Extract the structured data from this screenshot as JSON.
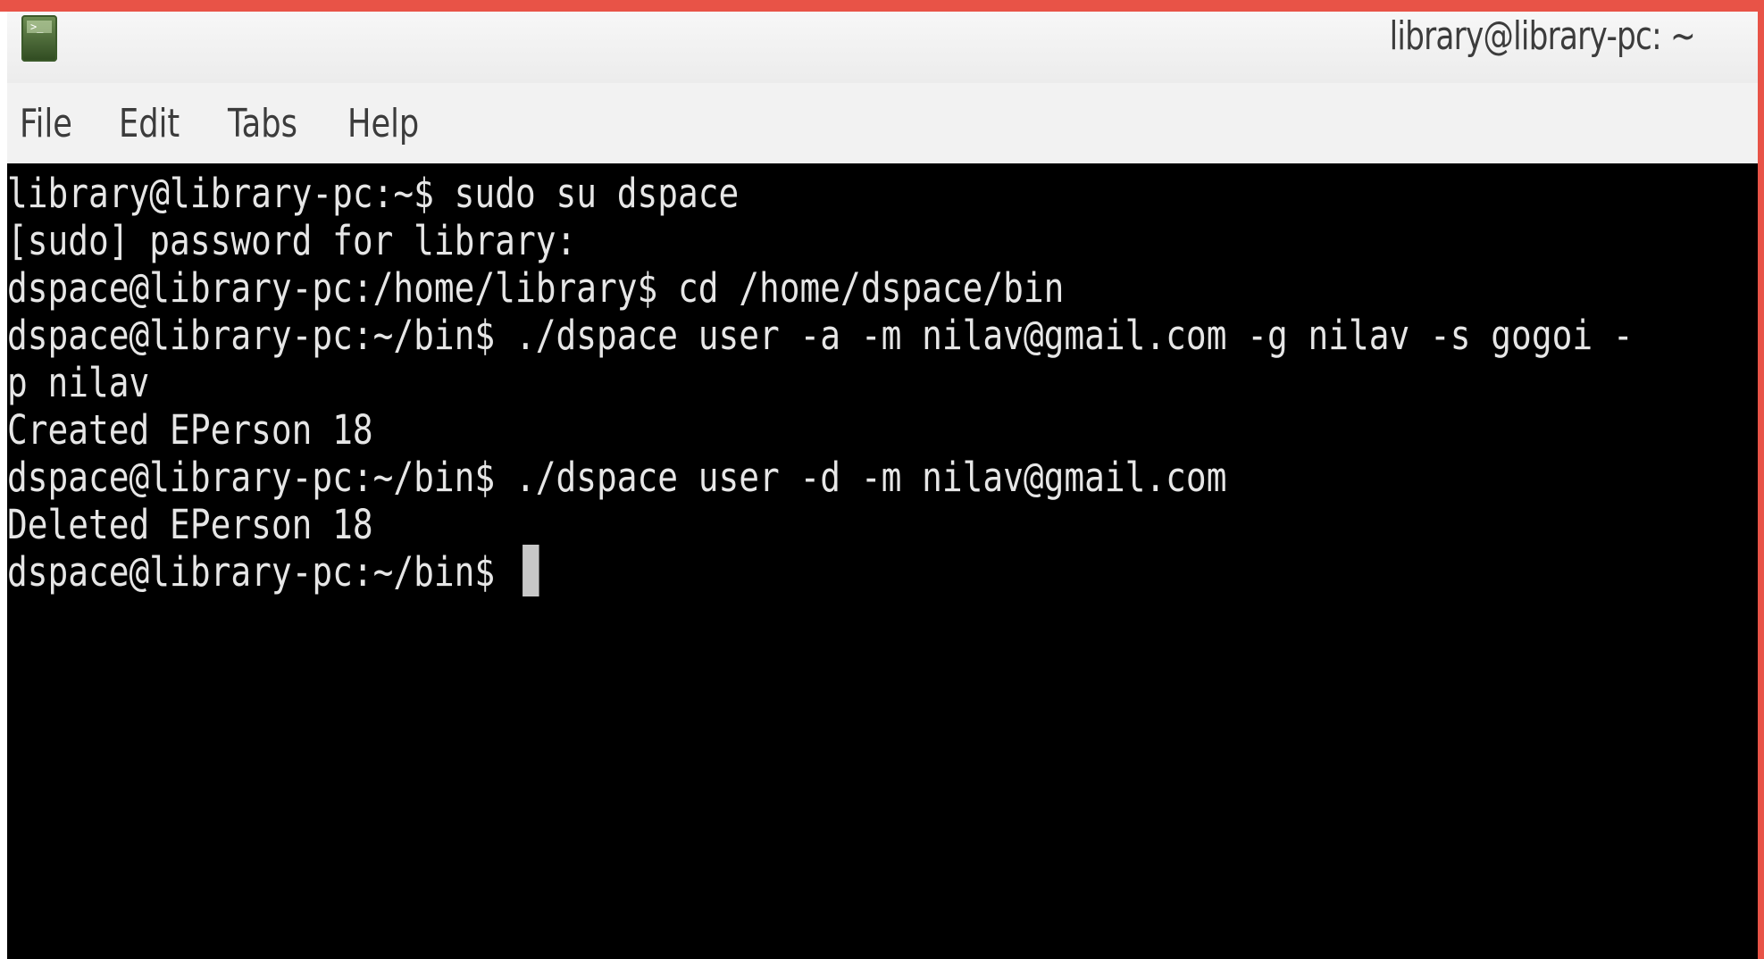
{
  "window": {
    "title": "library@library-pc: ~",
    "icon": "terminal-app-icon"
  },
  "menubar": {
    "items": [
      "File",
      "Edit",
      "Tabs",
      "Help"
    ]
  },
  "terminal": {
    "lines": [
      "library@library-pc:~$ sudo su dspace",
      "[sudo] password for library:",
      "dspace@library-pc:/home/library$ cd /home/dspace/bin",
      "dspace@library-pc:~/bin$ ./dspace user -a -m nilav@gmail.com -g nilav -s gogoi -",
      "p nilav",
      "Created EPerson 18",
      "dspace@library-pc:~/bin$ ./dspace user -d -m nilav@gmail.com",
      "Deleted EPerson 18"
    ],
    "prompt": "dspace@library-pc:~/bin$ "
  },
  "colors": {
    "accent": "#e85347",
    "terminal_bg": "#000000",
    "terminal_fg": "#e6e6e6"
  }
}
